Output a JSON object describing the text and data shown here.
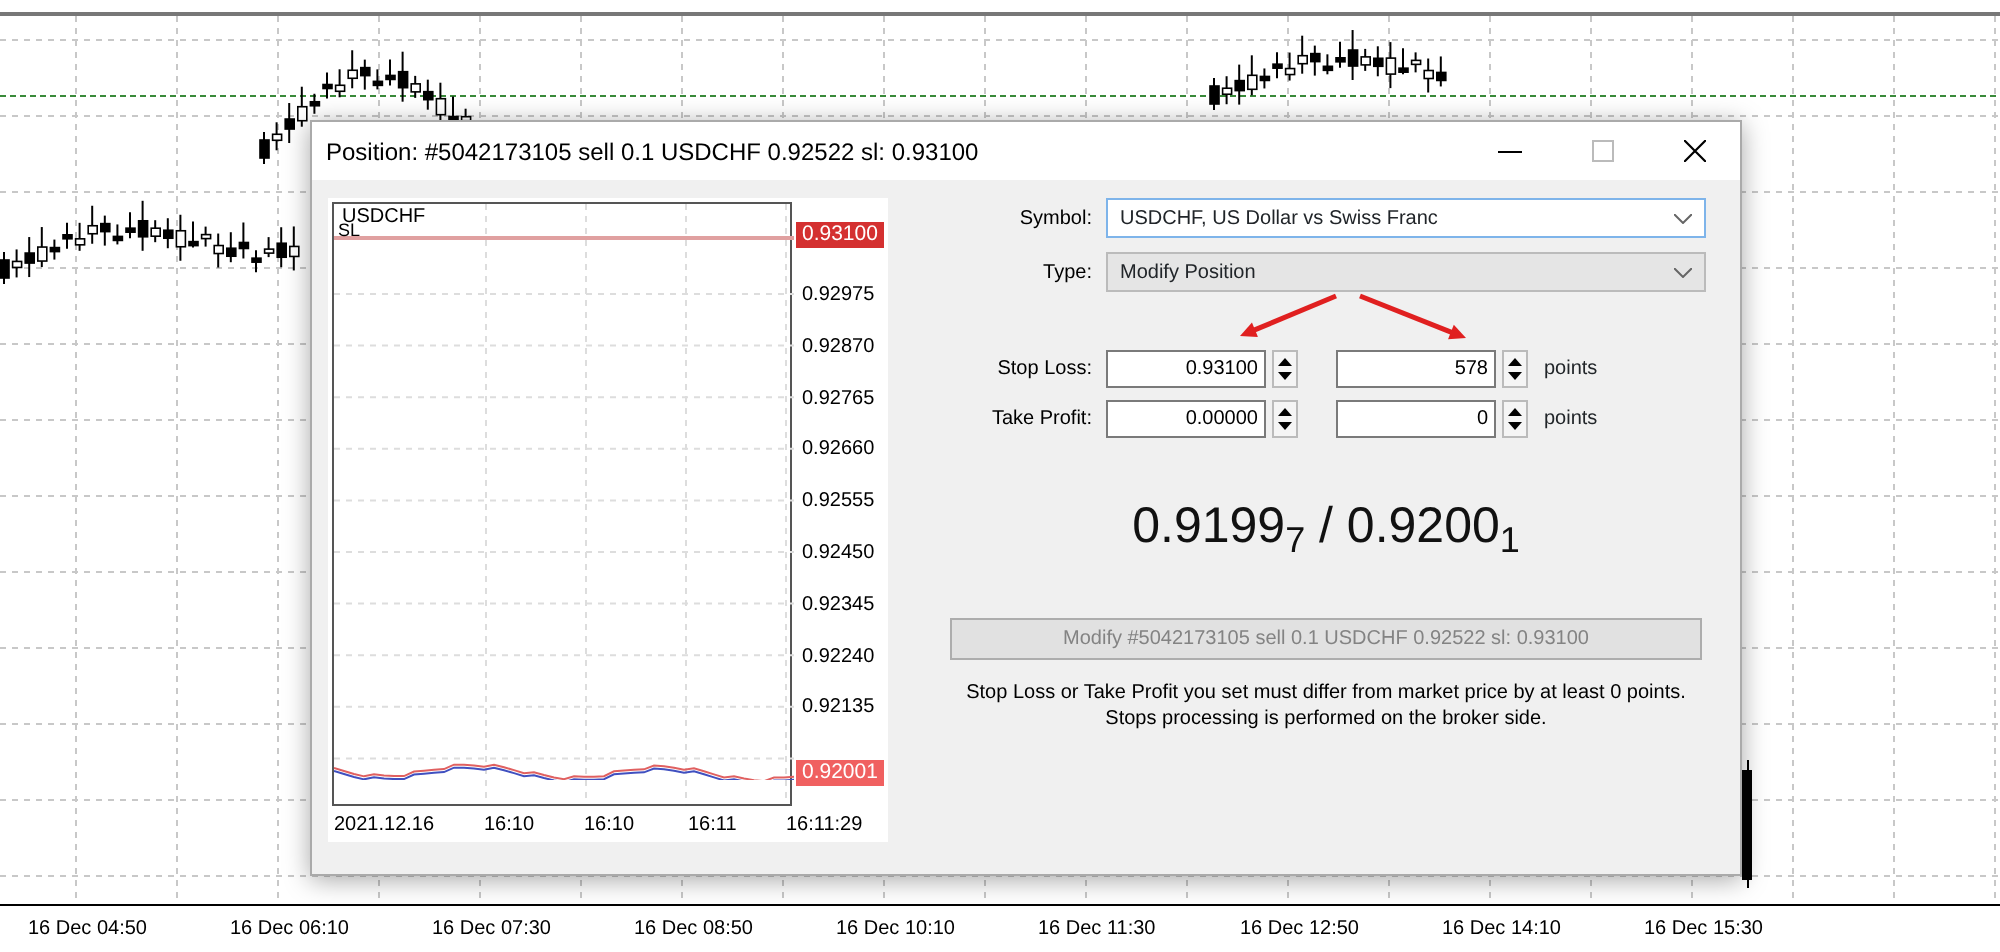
{
  "background_chart": {
    "time_labels": [
      "16 Dec 04:50",
      "16 Dec 06:10",
      "16 Dec 07:30",
      "16 Dec 08:50",
      "16 Dec 10:10",
      "16 Dec 11:30",
      "16 Dec 12:50",
      "16 Dec 14:10",
      "16 Dec 15:30"
    ]
  },
  "dialog": {
    "title": "Position: #5042173105 sell 0.1 USDCHF 0.92522 sl: 0.93100",
    "mini_chart": {
      "symbol": "USDCHF",
      "sl_marker": "SL",
      "price_axis": [
        "0.92975",
        "0.92870",
        "0.92765",
        "0.92660",
        "0.92555",
        "0.92450",
        "0.92345",
        "0.92240",
        "0.92135"
      ],
      "time_axis": [
        "2021.12.16",
        "16:10",
        "16:10",
        "16:11",
        "16:11:29"
      ],
      "sl_tag": "0.93100",
      "price_tag": "0.92001"
    },
    "symbol": {
      "label": "Symbol:",
      "value": "USDCHF, US Dollar vs Swiss Franc",
      "disabled": false
    },
    "type": {
      "label": "Type:",
      "value": "Modify Position",
      "disabled": true
    },
    "levels": [
      {
        "label": "Stop Loss:",
        "price": "0.93100",
        "points": "578",
        "unit": "points"
      },
      {
        "label": "Take Profit:",
        "price": "0.00000",
        "points": "0",
        "unit": "points"
      }
    ],
    "quote": "0.9199$_{7}$ / 0.9200$_{1}$",
    "modify_button": {
      "label": "Modify #5042173105 sell 0.1 USDCHF 0.92522 sl: 0.93100",
      "disabled": true
    },
    "note_lines": [
      "Stop Loss or Take Profit you set must differ from market price by at least 0 points.",
      "Stops processing is performed on the broker side."
    ]
  }
}
